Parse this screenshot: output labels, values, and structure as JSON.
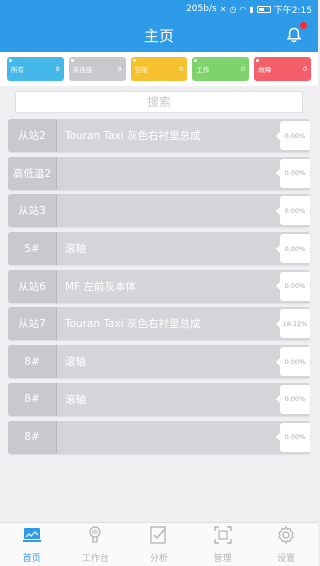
{
  "status_bar": {
    "speed": "205b/s",
    "time": "下午2:15"
  },
  "header": {
    "title": "主页"
  },
  "filters": [
    {
      "label": "所有",
      "count": "9",
      "color": "#45b8ea"
    },
    {
      "label": "未连接",
      "count": "9",
      "color": "#c9c9cd"
    },
    {
      "label": "空闲",
      "count": "0",
      "color": "#f6c12e"
    },
    {
      "label": "工作",
      "count": "0",
      "color": "#7ed36a"
    },
    {
      "label": "故障",
      "count": "0",
      "color": "#f45f6a"
    }
  ],
  "search": {
    "placeholder": "搜索"
  },
  "rows": [
    {
      "id": "从站2",
      "name": "Touran Taxi 灰色右衬里总成",
      "pct": "0.00%"
    },
    {
      "id": "高低温2",
      "name": "",
      "pct": "0.00%"
    },
    {
      "id": "从站3",
      "name": "",
      "pct": "0.00%"
    },
    {
      "id": "5#",
      "name": "滚轴",
      "pct": "0.00%"
    },
    {
      "id": "从站6",
      "name": "MF 左前灰本体",
      "pct": "0.00%"
    },
    {
      "id": "从站7",
      "name": "Touran Taxi 灰色右衬里总成",
      "pct": "18.12%"
    },
    {
      "id": "8#",
      "name": "滚轴",
      "pct": "0.00%"
    },
    {
      "id": "8#",
      "name": "滚轴",
      "pct": "0.00%"
    },
    {
      "id": "8#",
      "name": "",
      "pct": "0.00%"
    }
  ],
  "tabs": [
    {
      "label": "首页",
      "icon": "home-monitor-icon",
      "active": true
    },
    {
      "label": "工作台",
      "icon": "workbench-icon",
      "active": false
    },
    {
      "label": "分析",
      "icon": "analysis-icon",
      "active": false
    },
    {
      "label": "管理",
      "icon": "manage-icon",
      "active": false
    },
    {
      "label": "设置",
      "icon": "settings-gear-icon",
      "active": false
    }
  ],
  "colors": {
    "primary": "#2e9be8",
    "row_bg": "#d5d5d9",
    "notify_dot": "#ff2a2a"
  }
}
